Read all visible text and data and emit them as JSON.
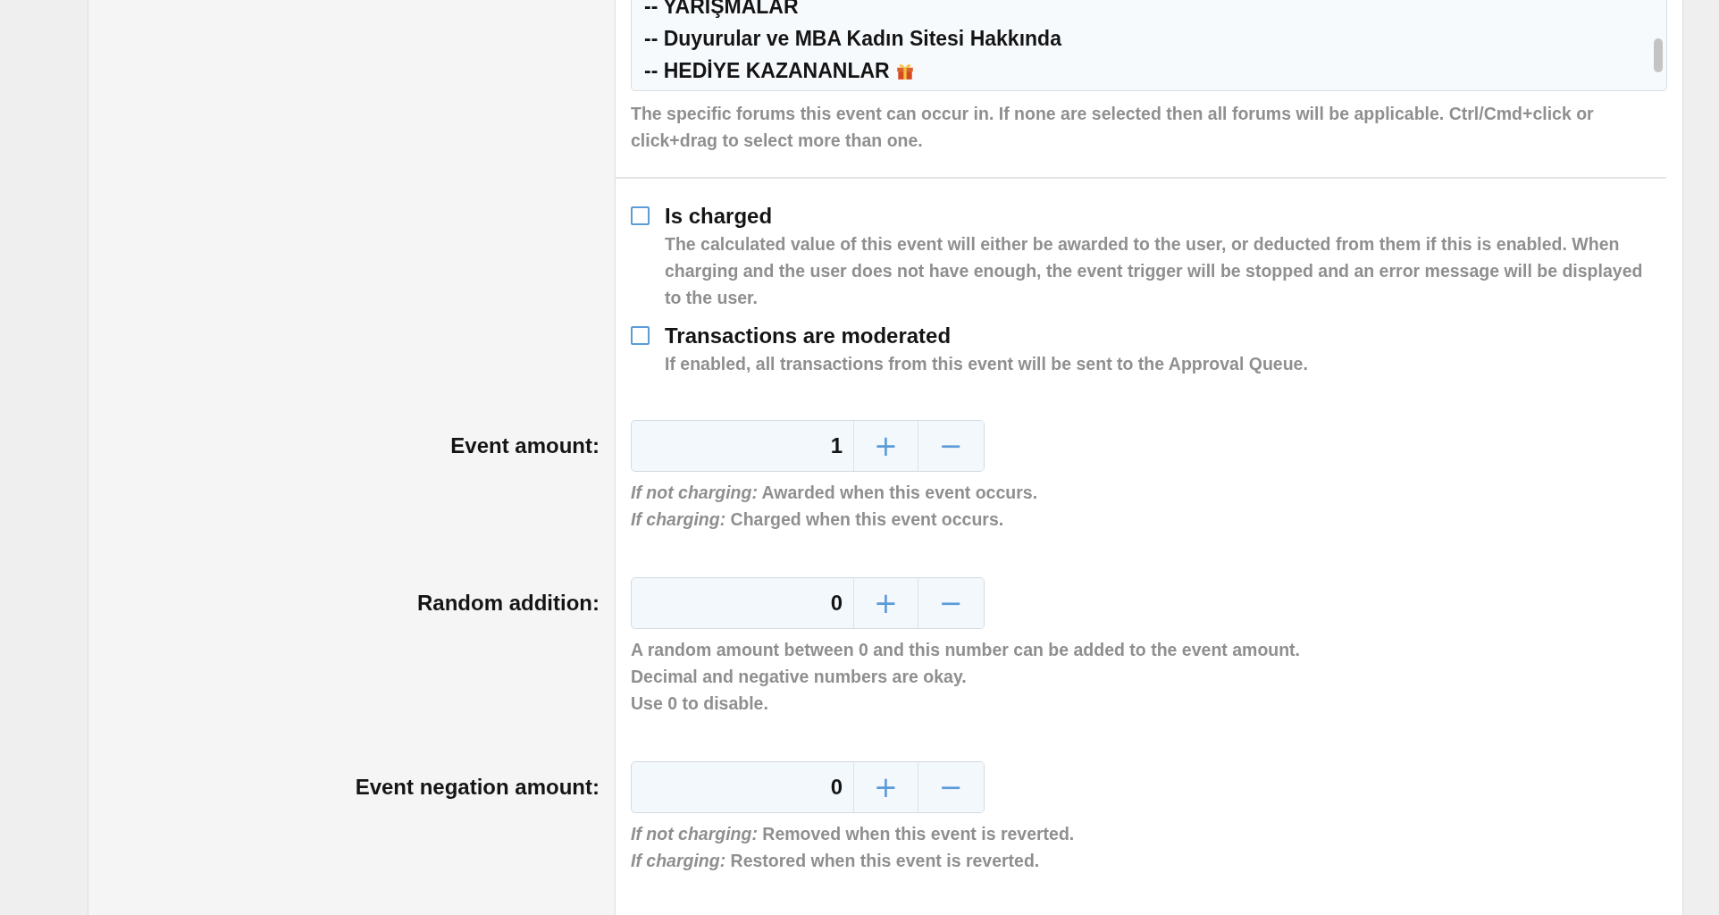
{
  "forums": {
    "items": [
      {
        "label": "-- YARIŞMALAR",
        "selected": false,
        "kind": "plain"
      },
      {
        "label": "-- Duyurular ve MBA Kadın Sitesi Hakkında",
        "selected": false,
        "kind": "plain"
      },
      {
        "label": "-- HEDİYE KAZANANLAR",
        "selected": false,
        "kind": "icon"
      }
    ],
    "hint": "The specific forums this event can occur in. If none are selected then all forums will be applicable. Ctrl/Cmd+click or click+drag to select more than one."
  },
  "options": [
    {
      "label": "Is charged",
      "checked": false,
      "description": "The calculated value of this event will either be awarded to the user, or deducted from them if this is enabled. When charging and the user does not have enough, the event trigger will be stopped and an error message will be displayed to the user."
    },
    {
      "label": "Transactions are moderated",
      "checked": false,
      "description": "If enabled, all transactions from this event will be sent to the Approval Queue."
    }
  ],
  "fields": [
    {
      "label": "Event amount:",
      "value": "1",
      "increment": "+",
      "decrement": "−",
      "hints": [
        "*If not charging:* Awarded when this event occurs.",
        "*If charging:* Charged when this event occurs."
      ]
    },
    {
      "label": "Random addition:",
      "value": "0",
      "increment": "+",
      "decrement": "−",
      "hints": [
        "A random amount between 0 and this number can be added to the event amount.",
        "Decimal and negative numbers are okay.",
        "Use 0 to disable."
      ]
    },
    {
      "label": "Event negation amount:",
      "value": "0",
      "increment": "+",
      "decrement": "−",
      "hints": [
        "*If not charging:* Removed when this event is reverted.",
        "*If charging:* Restored when this event is reverted."
      ]
    }
  ]
}
